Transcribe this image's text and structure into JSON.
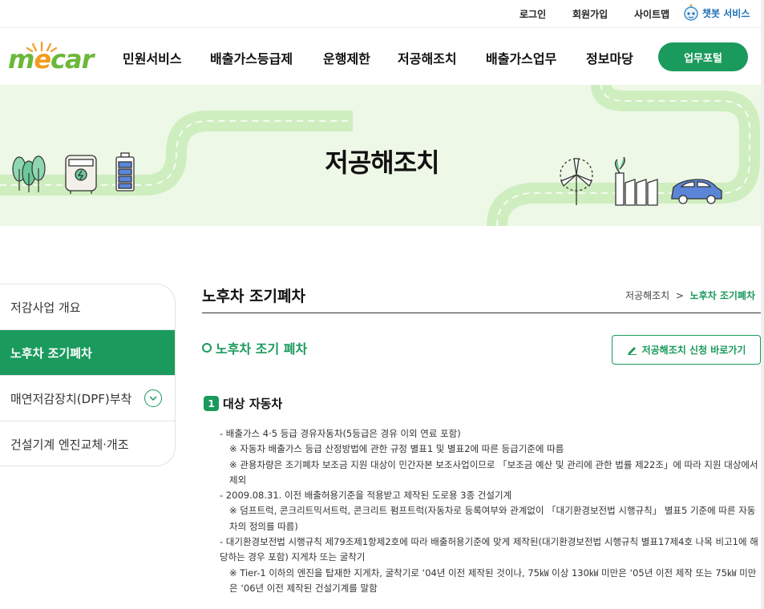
{
  "topbar": {
    "login": "로그인",
    "signup": "회원가입",
    "sitemap": "사이트맵",
    "chatbot": "챗봇 서비스"
  },
  "logo": {
    "text_a": "m",
    "text_b": "e",
    "text_c": "car"
  },
  "nav": {
    "items": [
      "민원서비스",
      "배출가스등급제",
      "운행제한",
      "저공해조치",
      "배출가스업무",
      "정보마당"
    ],
    "portal": "업무포털"
  },
  "banner": {
    "title": "저공해조치"
  },
  "sidebar": {
    "items": [
      "저감사업 개요",
      "노후차 조기폐차",
      "매연저감장치(DPF)부착",
      "건설기계 엔진교체·개조"
    ],
    "active_index": 1
  },
  "content": {
    "title": "노후차 조기폐차",
    "breadcrumb_parent": "저공해조치",
    "breadcrumb_sep": ">",
    "breadcrumb_current": "노후차 조기폐차",
    "section_title": "노후차 조기 폐차",
    "apply_button": "저공해조치 신청 바로가기",
    "subsection_number": "1",
    "subsection_title": "대상 자동차",
    "lines": [
      "- 배출가스 4·5 등급 경유자동차(5등급은 경유 이외 연료 포함)",
      "※ 자동차 배출가스 등급 산정방법에 관한 규정 별표1 및 별표2에 따른 등급기준에 따름",
      "※ 관용차량은 조기폐차 보조금 지원 대상이 민간자본 보조사업이므로 「보조금 예산 및 관리에 관한 법률 제22조」에 따라 지원 대상에서 제외",
      "- 2009.08.31. 이전 배출허용기준을 적용받고 제작된 도로용 3종 건설기계",
      "※ 덤프트럭, 콘크리트믹서트럭, 콘크리트 펌프트럭(자동차로 등록여부와 관계없이 「대기환경보전법 시행규칙」 별표5 기준에 따른 자동차의 정의를 따름)",
      "- 대기환경보전법 시행규칙 제79조제1항제2호에 따라 배출허용기준에 맞게 제작된(대기환경보전법 시행규칙 별표17제4호 나목 비고1에 해당하는 경우 포함) 지게차 또는 굴착기",
      "※ Tier-1 이하의 엔진을 탑재한 지게차, 굴착기로 ‘04년 이전 제작된 것이나, 75㎾ 이상 130㎾ 미만은 ‘05년 이전 제작 또는 75㎾ 미만은 ‘06년 이전 제작된 건설기계를 말함"
    ]
  },
  "colors": {
    "brand_green": "#1a9a5c",
    "banner_bg": "#eef8e6",
    "logo_green": "#6bb83a",
    "logo_orange": "#f29b1d"
  }
}
